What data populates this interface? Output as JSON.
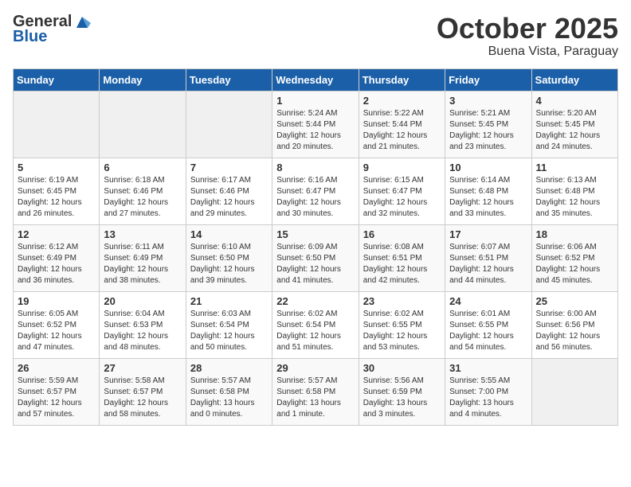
{
  "logo": {
    "general": "General",
    "blue": "Blue"
  },
  "title": {
    "month": "October 2025",
    "location": "Buena Vista, Paraguay"
  },
  "headers": [
    "Sunday",
    "Monday",
    "Tuesday",
    "Wednesday",
    "Thursday",
    "Friday",
    "Saturday"
  ],
  "weeks": [
    [
      {
        "day": "",
        "info": ""
      },
      {
        "day": "",
        "info": ""
      },
      {
        "day": "",
        "info": ""
      },
      {
        "day": "1",
        "info": "Sunrise: 5:24 AM\nSunset: 5:44 PM\nDaylight: 12 hours\nand 20 minutes."
      },
      {
        "day": "2",
        "info": "Sunrise: 5:22 AM\nSunset: 5:44 PM\nDaylight: 12 hours\nand 21 minutes."
      },
      {
        "day": "3",
        "info": "Sunrise: 5:21 AM\nSunset: 5:45 PM\nDaylight: 12 hours\nand 23 minutes."
      },
      {
        "day": "4",
        "info": "Sunrise: 5:20 AM\nSunset: 5:45 PM\nDaylight: 12 hours\nand 24 minutes."
      }
    ],
    [
      {
        "day": "5",
        "info": "Sunrise: 6:19 AM\nSunset: 6:45 PM\nDaylight: 12 hours\nand 26 minutes."
      },
      {
        "day": "6",
        "info": "Sunrise: 6:18 AM\nSunset: 6:46 PM\nDaylight: 12 hours\nand 27 minutes."
      },
      {
        "day": "7",
        "info": "Sunrise: 6:17 AM\nSunset: 6:46 PM\nDaylight: 12 hours\nand 29 minutes."
      },
      {
        "day": "8",
        "info": "Sunrise: 6:16 AM\nSunset: 6:47 PM\nDaylight: 12 hours\nand 30 minutes."
      },
      {
        "day": "9",
        "info": "Sunrise: 6:15 AM\nSunset: 6:47 PM\nDaylight: 12 hours\nand 32 minutes."
      },
      {
        "day": "10",
        "info": "Sunrise: 6:14 AM\nSunset: 6:48 PM\nDaylight: 12 hours\nand 33 minutes."
      },
      {
        "day": "11",
        "info": "Sunrise: 6:13 AM\nSunset: 6:48 PM\nDaylight: 12 hours\nand 35 minutes."
      }
    ],
    [
      {
        "day": "12",
        "info": "Sunrise: 6:12 AM\nSunset: 6:49 PM\nDaylight: 12 hours\nand 36 minutes."
      },
      {
        "day": "13",
        "info": "Sunrise: 6:11 AM\nSunset: 6:49 PM\nDaylight: 12 hours\nand 38 minutes."
      },
      {
        "day": "14",
        "info": "Sunrise: 6:10 AM\nSunset: 6:50 PM\nDaylight: 12 hours\nand 39 minutes."
      },
      {
        "day": "15",
        "info": "Sunrise: 6:09 AM\nSunset: 6:50 PM\nDaylight: 12 hours\nand 41 minutes."
      },
      {
        "day": "16",
        "info": "Sunrise: 6:08 AM\nSunset: 6:51 PM\nDaylight: 12 hours\nand 42 minutes."
      },
      {
        "day": "17",
        "info": "Sunrise: 6:07 AM\nSunset: 6:51 PM\nDaylight: 12 hours\nand 44 minutes."
      },
      {
        "day": "18",
        "info": "Sunrise: 6:06 AM\nSunset: 6:52 PM\nDaylight: 12 hours\nand 45 minutes."
      }
    ],
    [
      {
        "day": "19",
        "info": "Sunrise: 6:05 AM\nSunset: 6:52 PM\nDaylight: 12 hours\nand 47 minutes."
      },
      {
        "day": "20",
        "info": "Sunrise: 6:04 AM\nSunset: 6:53 PM\nDaylight: 12 hours\nand 48 minutes."
      },
      {
        "day": "21",
        "info": "Sunrise: 6:03 AM\nSunset: 6:54 PM\nDaylight: 12 hours\nand 50 minutes."
      },
      {
        "day": "22",
        "info": "Sunrise: 6:02 AM\nSunset: 6:54 PM\nDaylight: 12 hours\nand 51 minutes."
      },
      {
        "day": "23",
        "info": "Sunrise: 6:02 AM\nSunset: 6:55 PM\nDaylight: 12 hours\nand 53 minutes."
      },
      {
        "day": "24",
        "info": "Sunrise: 6:01 AM\nSunset: 6:55 PM\nDaylight: 12 hours\nand 54 minutes."
      },
      {
        "day": "25",
        "info": "Sunrise: 6:00 AM\nSunset: 6:56 PM\nDaylight: 12 hours\nand 56 minutes."
      }
    ],
    [
      {
        "day": "26",
        "info": "Sunrise: 5:59 AM\nSunset: 6:57 PM\nDaylight: 12 hours\nand 57 minutes."
      },
      {
        "day": "27",
        "info": "Sunrise: 5:58 AM\nSunset: 6:57 PM\nDaylight: 12 hours\nand 58 minutes."
      },
      {
        "day": "28",
        "info": "Sunrise: 5:57 AM\nSunset: 6:58 PM\nDaylight: 13 hours\nand 0 minutes."
      },
      {
        "day": "29",
        "info": "Sunrise: 5:57 AM\nSunset: 6:58 PM\nDaylight: 13 hours\nand 1 minute."
      },
      {
        "day": "30",
        "info": "Sunrise: 5:56 AM\nSunset: 6:59 PM\nDaylight: 13 hours\nand 3 minutes."
      },
      {
        "day": "31",
        "info": "Sunrise: 5:55 AM\nSunset: 7:00 PM\nDaylight: 13 hours\nand 4 minutes."
      },
      {
        "day": "",
        "info": ""
      }
    ]
  ]
}
